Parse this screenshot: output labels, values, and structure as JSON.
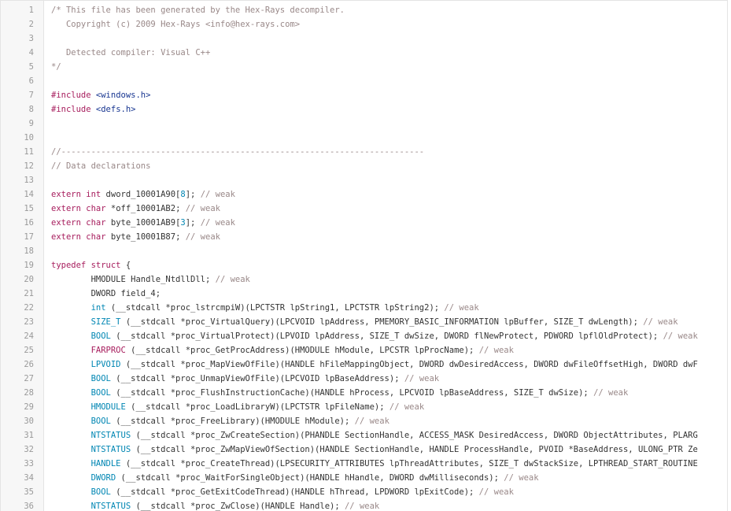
{
  "lines": [
    {
      "n": "1",
      "t": [
        {
          "c": "comment",
          "v": "/* This file has been generated by the Hex-Rays decompiler."
        }
      ]
    },
    {
      "n": "2",
      "t": [
        {
          "c": "comment",
          "v": "   Copyright (c) 2009 Hex-Rays <info@hex-rays.com>"
        }
      ]
    },
    {
      "n": "3",
      "t": []
    },
    {
      "n": "4",
      "t": [
        {
          "c": "comment",
          "v": "   Detected compiler: Visual C++"
        }
      ]
    },
    {
      "n": "5",
      "t": [
        {
          "c": "comment",
          "v": "*/"
        }
      ]
    },
    {
      "n": "6",
      "t": []
    },
    {
      "n": "7",
      "t": [
        {
          "c": "pp",
          "v": "#include "
        },
        {
          "c": "str",
          "v": "<windows.h>"
        }
      ]
    },
    {
      "n": "8",
      "t": [
        {
          "c": "pp",
          "v": "#include "
        },
        {
          "c": "str",
          "v": "<defs.h>"
        }
      ]
    },
    {
      "n": "9",
      "t": []
    },
    {
      "n": "10",
      "t": []
    },
    {
      "n": "11",
      "t": [
        {
          "c": "comment",
          "v": "//-------------------------------------------------------------------------"
        }
      ]
    },
    {
      "n": "12",
      "t": [
        {
          "c": "comment",
          "v": "// Data declarations"
        }
      ]
    },
    {
      "n": "13",
      "t": []
    },
    {
      "n": "14",
      "t": [
        {
          "c": "kw",
          "v": "extern "
        },
        {
          "c": "kw",
          "v": "int"
        },
        {
          "c": "plain",
          "v": " dword_10001A90["
        },
        {
          "c": "num",
          "v": "8"
        },
        {
          "c": "plain",
          "v": "]; "
        },
        {
          "c": "comment",
          "v": "// weak"
        }
      ]
    },
    {
      "n": "15",
      "t": [
        {
          "c": "kw",
          "v": "extern "
        },
        {
          "c": "kw",
          "v": "char"
        },
        {
          "c": "plain",
          "v": " *off_10001AB2; "
        },
        {
          "c": "comment",
          "v": "// weak"
        }
      ]
    },
    {
      "n": "16",
      "t": [
        {
          "c": "kw",
          "v": "extern "
        },
        {
          "c": "kw",
          "v": "char"
        },
        {
          "c": "plain",
          "v": " byte_10001AB9["
        },
        {
          "c": "num",
          "v": "3"
        },
        {
          "c": "plain",
          "v": "]; "
        },
        {
          "c": "comment",
          "v": "// weak"
        }
      ]
    },
    {
      "n": "17",
      "t": [
        {
          "c": "kw",
          "v": "extern "
        },
        {
          "c": "kw",
          "v": "char"
        },
        {
          "c": "plain",
          "v": " byte_10001B87; "
        },
        {
          "c": "comment",
          "v": "// weak"
        }
      ]
    },
    {
      "n": "18",
      "t": []
    },
    {
      "n": "19",
      "t": [
        {
          "c": "kw",
          "v": "typedef "
        },
        {
          "c": "kw",
          "v": "struct"
        },
        {
          "c": "plain",
          "v": " {"
        }
      ]
    },
    {
      "n": "20",
      "t": [
        {
          "c": "plain",
          "v": "        HMODULE Handle_NtdllDll; "
        },
        {
          "c": "comment",
          "v": "// weak"
        }
      ]
    },
    {
      "n": "21",
      "t": [
        {
          "c": "plain",
          "v": "        DWORD field_4;"
        }
      ]
    },
    {
      "n": "22",
      "t": [
        {
          "c": "plain",
          "v": "        "
        },
        {
          "c": "type",
          "v": "int"
        },
        {
          "c": "plain",
          "v": " (__stdcall *proc_lstrcmpiW)(LPCTSTR lpString1, LPCTSTR lpString2); "
        },
        {
          "c": "comment",
          "v": "// weak"
        }
      ]
    },
    {
      "n": "23",
      "t": [
        {
          "c": "plain",
          "v": "        "
        },
        {
          "c": "type",
          "v": "SIZE_T"
        },
        {
          "c": "plain",
          "v": " (__stdcall *proc_VirtualQuery)(LPCVOID lpAddress, PMEMORY_BASIC_INFORMATION lpBuffer, SIZE_T dwLength); "
        },
        {
          "c": "comment",
          "v": "// weak"
        }
      ]
    },
    {
      "n": "24",
      "t": [
        {
          "c": "plain",
          "v": "        "
        },
        {
          "c": "type",
          "v": "BOOL"
        },
        {
          "c": "plain",
          "v": " (__stdcall *proc_VirtualProtect)(LPVOID lpAddress, SIZE_T dwSize, DWORD flNewProtect, PDWORD lpflOldProtect); "
        },
        {
          "c": "comment",
          "v": "// weak"
        }
      ]
    },
    {
      "n": "25",
      "t": [
        {
          "c": "plain",
          "v": "        "
        },
        {
          "c": "kw",
          "v": "FARPROC"
        },
        {
          "c": "plain",
          "v": " (__stdcall *proc_GetProcAddress)(HMODULE hModule, LPCSTR lpProcName); "
        },
        {
          "c": "comment",
          "v": "// weak"
        }
      ]
    },
    {
      "n": "26",
      "t": [
        {
          "c": "plain",
          "v": "        "
        },
        {
          "c": "type",
          "v": "LPVOID"
        },
        {
          "c": "plain",
          "v": " (__stdcall *proc_MapViewOfFile)(HANDLE hFileMappingObject, DWORD dwDesiredAccess, DWORD dwFileOffsetHigh, DWORD dwF"
        }
      ]
    },
    {
      "n": "27",
      "t": [
        {
          "c": "plain",
          "v": "        "
        },
        {
          "c": "type",
          "v": "BOOL"
        },
        {
          "c": "plain",
          "v": " (__stdcall *proc_UnmapViewOfFile)(LPCVOID lpBaseAddress); "
        },
        {
          "c": "comment",
          "v": "// weak"
        }
      ]
    },
    {
      "n": "28",
      "t": [
        {
          "c": "plain",
          "v": "        "
        },
        {
          "c": "type",
          "v": "BOOL"
        },
        {
          "c": "plain",
          "v": " (__stdcall *proc_FlushInstructionCache)(HANDLE hProcess, LPCVOID lpBaseAddress, SIZE_T dwSize); "
        },
        {
          "c": "comment",
          "v": "// weak"
        }
      ]
    },
    {
      "n": "29",
      "t": [
        {
          "c": "plain",
          "v": "        "
        },
        {
          "c": "type",
          "v": "HMODULE"
        },
        {
          "c": "plain",
          "v": " (__stdcall *proc_LoadLibraryW)(LPCTSTR lpFileName); "
        },
        {
          "c": "comment",
          "v": "// weak"
        }
      ]
    },
    {
      "n": "30",
      "t": [
        {
          "c": "plain",
          "v": "        "
        },
        {
          "c": "type",
          "v": "BOOL"
        },
        {
          "c": "plain",
          "v": " (__stdcall *proc_FreeLibrary)(HMODULE hModule); "
        },
        {
          "c": "comment",
          "v": "// weak"
        }
      ]
    },
    {
      "n": "31",
      "t": [
        {
          "c": "plain",
          "v": "        "
        },
        {
          "c": "type",
          "v": "NTSTATUS"
        },
        {
          "c": "plain",
          "v": " (__stdcall *proc_ZwCreateSection)(PHANDLE SectionHandle, ACCESS_MASK DesiredAccess, DWORD ObjectAttributes, PLARG"
        }
      ]
    },
    {
      "n": "32",
      "t": [
        {
          "c": "plain",
          "v": "        "
        },
        {
          "c": "type",
          "v": "NTSTATUS"
        },
        {
          "c": "plain",
          "v": " (__stdcall *proc_ZwMapViewOfSection)(HANDLE SectionHandle, HANDLE ProcessHandle, PVOID *BaseAddress, ULONG_PTR Ze"
        }
      ]
    },
    {
      "n": "33",
      "t": [
        {
          "c": "plain",
          "v": "        "
        },
        {
          "c": "type",
          "v": "HANDLE"
        },
        {
          "c": "plain",
          "v": " (__stdcall *proc_CreateThread)(LPSECURITY_ATTRIBUTES lpThreadAttributes, SIZE_T dwStackSize, LPTHREAD_START_ROUTINE"
        }
      ]
    },
    {
      "n": "34",
      "t": [
        {
          "c": "plain",
          "v": "        "
        },
        {
          "c": "type",
          "v": "DWORD"
        },
        {
          "c": "plain",
          "v": " (__stdcall *proc_WaitForSingleObject)(HANDLE hHandle, DWORD dwMilliseconds); "
        },
        {
          "c": "comment",
          "v": "// weak"
        }
      ]
    },
    {
      "n": "35",
      "t": [
        {
          "c": "plain",
          "v": "        "
        },
        {
          "c": "type",
          "v": "BOOL"
        },
        {
          "c": "plain",
          "v": " (__stdcall *proc_GetExitCodeThread)(HANDLE hThread, LPDWORD lpExitCode); "
        },
        {
          "c": "comment",
          "v": "// weak"
        }
      ]
    },
    {
      "n": "36",
      "t": [
        {
          "c": "plain",
          "v": "        "
        },
        {
          "c": "type",
          "v": "NTSTATUS"
        },
        {
          "c": "plain",
          "v": " (__stdcall *proc_ZwClose)(HANDLE Handle); "
        },
        {
          "c": "comment",
          "v": "// weak"
        }
      ]
    }
  ]
}
